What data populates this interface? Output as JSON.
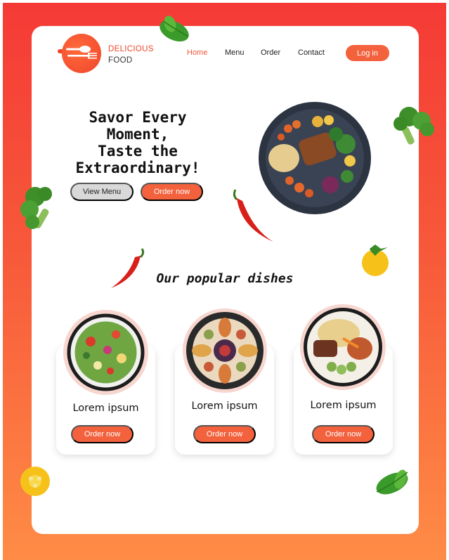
{
  "brand": {
    "line1": "DELICIOUS",
    "line2": "FOOD"
  },
  "nav": {
    "home": "Home",
    "menu": "Menu",
    "order": "Order",
    "contact": "Contact",
    "login": "Log in"
  },
  "hero": {
    "title_lines": [
      "Savor Every",
      "Moment,",
      "Taste the",
      "Extraordinary!"
    ],
    "view_menu": "View Menu",
    "order_now": "Order now"
  },
  "popular": {
    "title": "Our popular dishes",
    "dishes": [
      {
        "name": "Lorem ipsum",
        "button": "Order now"
      },
      {
        "name": "Lorem ipsum",
        "button": "Order now"
      },
      {
        "name": "Lorem ipsum",
        "button": "Order now"
      }
    ]
  },
  "colors": {
    "accent": "#f3613d",
    "frame_top": "#f53a36",
    "frame_bottom": "#ff8c46",
    "secondary_button": "#d9d9d9"
  },
  "icons": {
    "logo": "fork-spoon-icon",
    "decorations": [
      "basil-leaf-icon",
      "broccoli-icon",
      "chili-pepper-icon",
      "yellow-tomato-icon"
    ]
  }
}
